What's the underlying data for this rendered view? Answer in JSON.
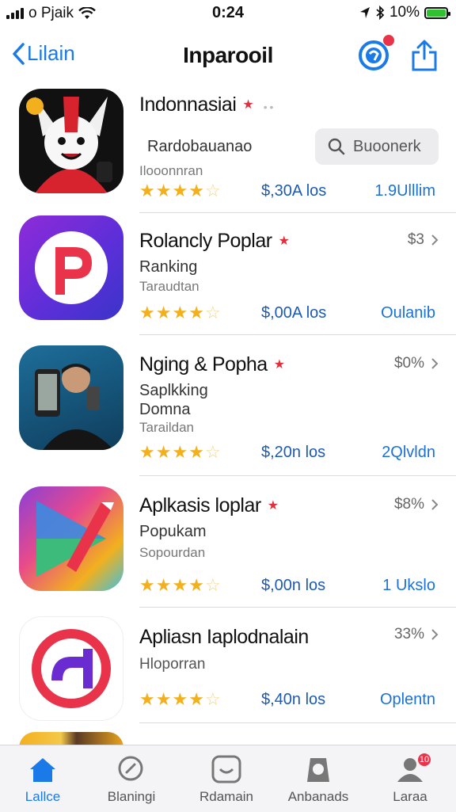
{
  "status_bar": {
    "carrier": "o Pjaik",
    "time": "0:24",
    "battery_text": "10%"
  },
  "nav": {
    "back_label": "Lilain",
    "title": "Inparooil"
  },
  "apps": [
    {
      "name": "Indonnasiai",
      "subtitle": "Rardobauanao",
      "category": "Ilooonnran",
      "rating": 4.5,
      "price": "$,30A los",
      "downloads": "1.9Ulllim",
      "action_label": "Buoonerk"
    },
    {
      "name": "Rolancly Poplar",
      "subtitle": "Ranking",
      "category": "Taraudtan",
      "rating": 4.5,
      "price": "$,00A los",
      "downloads": "Oulanib",
      "right_value": "$3"
    },
    {
      "name": "Nging & Popha",
      "subtitle": "Saplkking",
      "subtitle2": "Domna",
      "category": "Taraildan",
      "rating": 4.5,
      "price": "$,20n los",
      "downloads": "2Qlvldn",
      "right_value": "$0%"
    },
    {
      "name": "Aplkasis loplar",
      "subtitle": "Popukam",
      "category": "Sopourdan",
      "rating": 4.5,
      "price": "$,00n los",
      "downloads": "1 Ukslo",
      "right_value": "$8%"
    },
    {
      "name": "Apliasn Iaplodnalain",
      "subtitle": "Hloporran",
      "rating": 4.5,
      "price": "$,40n los",
      "downloads": "Oplentn",
      "right_value": "33%"
    }
  ],
  "tabs": [
    {
      "label": "Lallce",
      "icon": "home-icon",
      "active": true
    },
    {
      "label": "Blaningi",
      "icon": "search-icon"
    },
    {
      "label": "Rdamain",
      "icon": "smile-icon"
    },
    {
      "label": "Anbanads",
      "icon": "apps-icon"
    },
    {
      "label": "Laraa",
      "icon": "profile-icon",
      "badge": "10"
    }
  ],
  "colors": {
    "accent": "#1a7ae8",
    "star": "#f2b01e",
    "badge": "#e8334a"
  }
}
